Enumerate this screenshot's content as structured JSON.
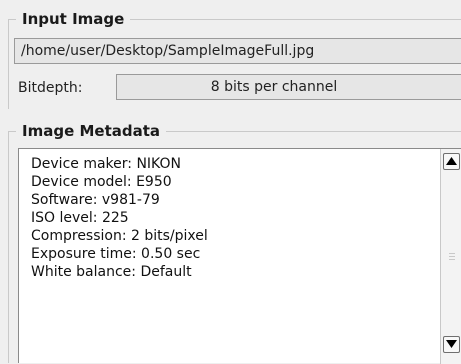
{
  "input_group": {
    "title": "Input Image",
    "path": "/home/user/Desktop/SampleImageFull.jpg",
    "bitdepth_label": "Bitdepth:",
    "bitdepth_value": "8 bits per channel"
  },
  "metadata_group": {
    "title": "Image Metadata",
    "items": [
      "Device maker: NIKON",
      "Device model: E950",
      "Software: v981-79",
      "ISO level: 225",
      "Compression: 2 bits/pixel",
      "Exposure time: 0.50 sec",
      "White balance: Default"
    ]
  },
  "icons": {
    "scroll_up": "arrow-up-icon",
    "scroll_down": "arrow-down-icon"
  }
}
